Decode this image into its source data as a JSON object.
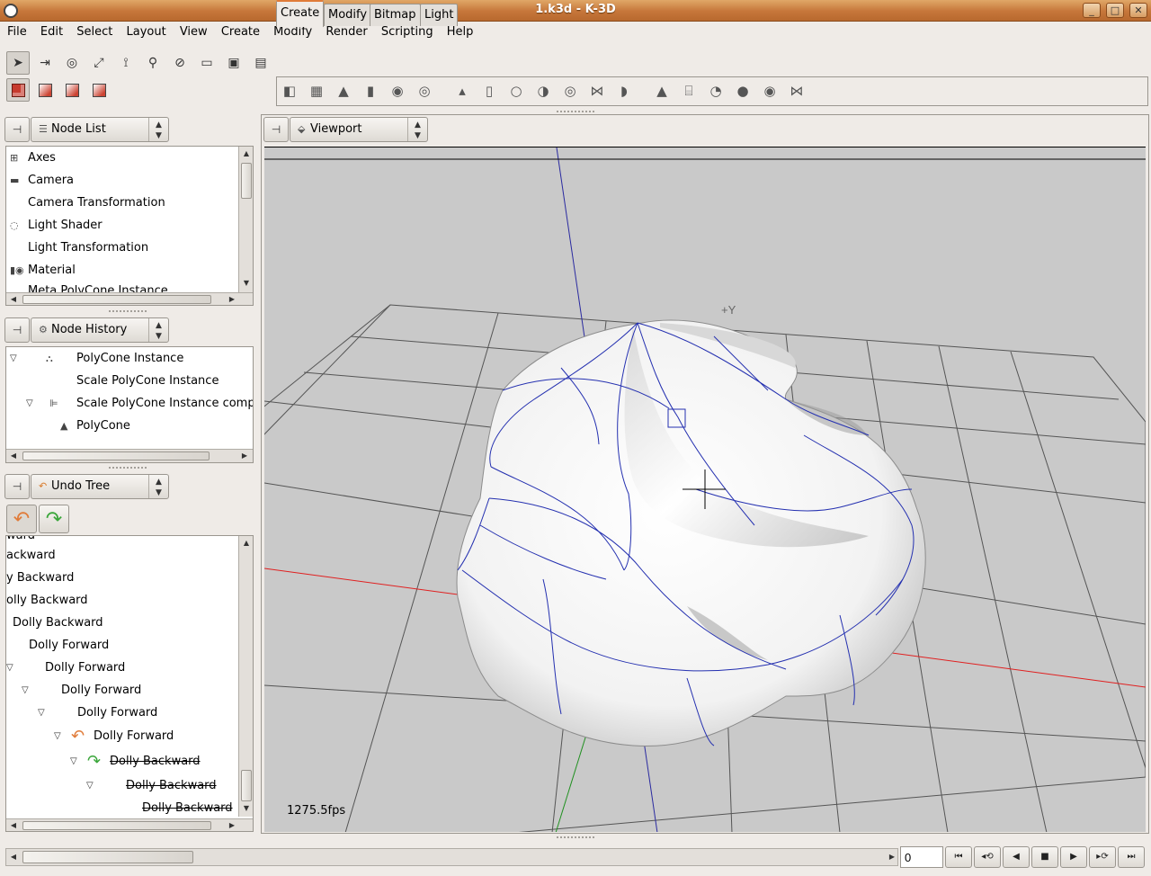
{
  "window": {
    "title": "1.k3d - K-3D"
  },
  "menu": [
    "File",
    "Edit",
    "Select",
    "Layout",
    "View",
    "Create",
    "Modify",
    "Render",
    "Scripting",
    "Help"
  ],
  "notebook": {
    "tabs": [
      "Create",
      "Modify",
      "Bitmap",
      "Light"
    ],
    "active_tab": "Create"
  },
  "node_list_panel": {
    "selector": "Node List",
    "items": [
      "Axes",
      "Camera",
      "Camera Transformation",
      "Light Shader",
      "Light Transformation",
      "Material",
      "Meta PolyCone Instance"
    ]
  },
  "node_history_panel": {
    "selector": "Node History",
    "items": [
      "PolyCone Instance",
      "Scale PolyCone Instance",
      "Scale PolyCone Instance comp",
      "PolyCone"
    ]
  },
  "undo_tree_panel": {
    "selector": "Undo Tree",
    "items": [
      "ward",
      "ackward",
      "y Backward",
      "olly Backward",
      "Dolly Backward",
      "Dolly Forward",
      "Dolly Forward",
      "Dolly Forward",
      "Dolly Forward",
      "Dolly Forward",
      "Dolly Backward",
      "Dolly Backward",
      "Dolly Backward"
    ]
  },
  "viewport_panel": {
    "selector": "Viewport",
    "axis_label": "+Y",
    "fps": "1275.5fps"
  },
  "timeline": {
    "frame": "0"
  },
  "colors": {
    "title_bar": "#c6763a",
    "accent": "#e07b39",
    "viewport_bg": "#c9c9c9",
    "x_axis": "#e02020",
    "y_axis": "#2a2aa0",
    "z_axis": "#209020"
  }
}
